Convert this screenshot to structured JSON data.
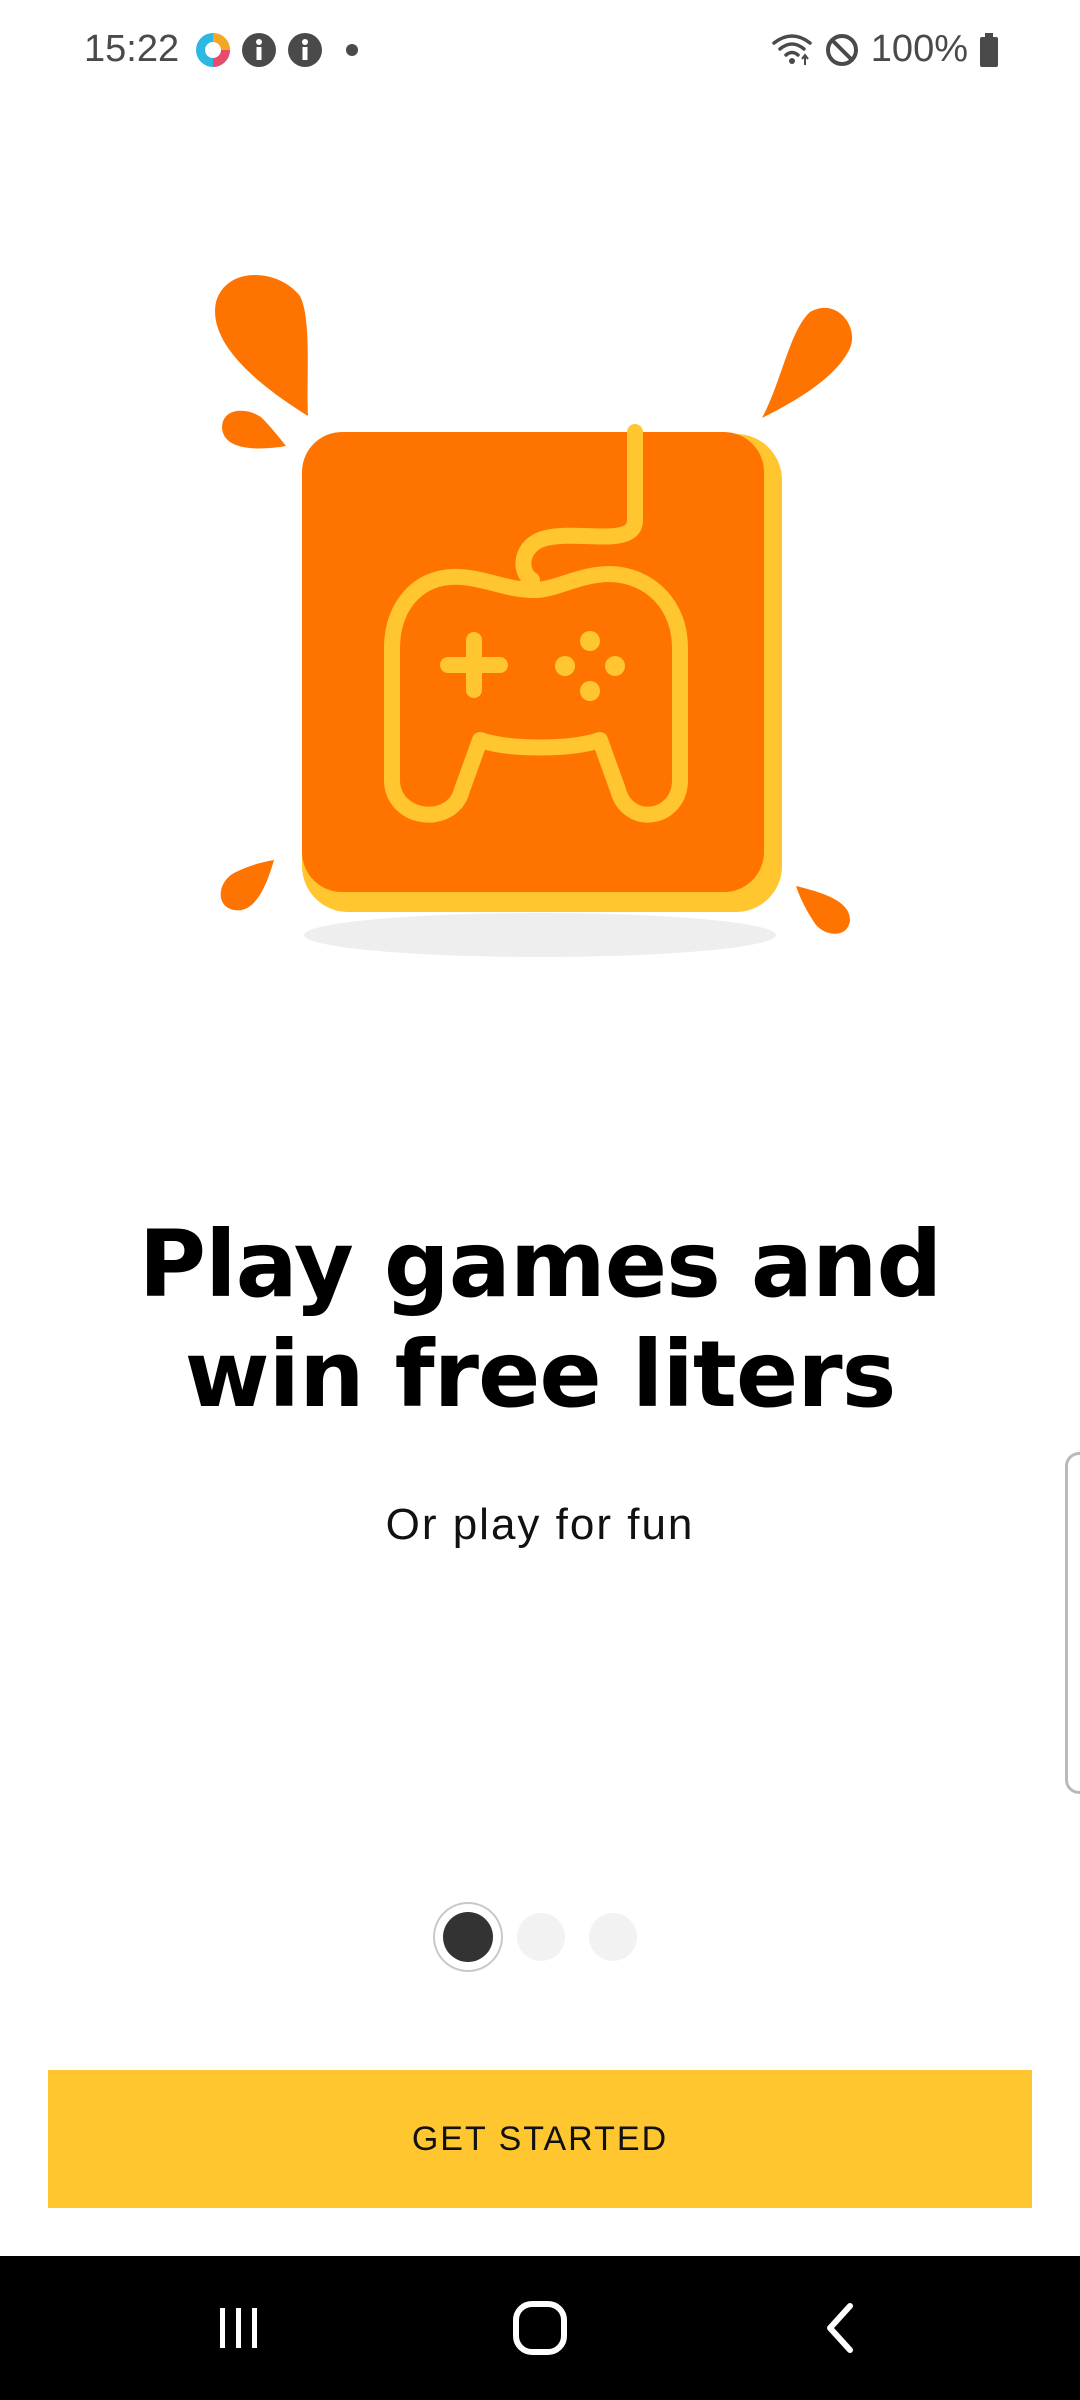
{
  "status_bar": {
    "time": "15:22",
    "battery": "100%",
    "left_icons": [
      "app-icon",
      "info-icon",
      "info-icon",
      "dot-icon"
    ],
    "right_icons": [
      "wifi-icon",
      "do-not-disturb-icon",
      "battery-icon"
    ]
  },
  "onboarding": {
    "headline": "Play games and win free liters",
    "subline": "Or play for fun",
    "illustration": "game-controller-icon",
    "pages_total": 3,
    "current_page": 1
  },
  "cta": {
    "label": "GET STARTED"
  },
  "nav_bar": {
    "buttons": [
      "recent-apps-icon",
      "home-icon",
      "back-icon"
    ]
  },
  "colors": {
    "accent_yellow": "#FFC62F",
    "brand_orange": "#FF7400",
    "dot_active": "#333333",
    "dot_inactive": "#F2F2F2"
  }
}
